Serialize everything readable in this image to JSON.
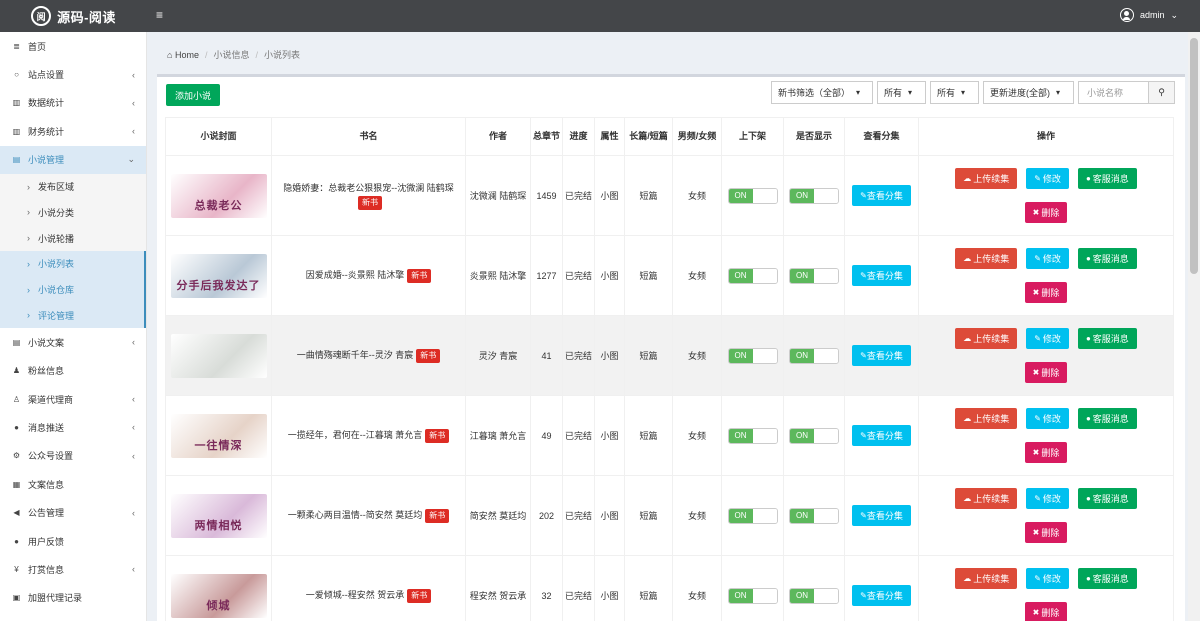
{
  "app": {
    "logo_mark": "阅",
    "title": "源码-阅读"
  },
  "header": {
    "menu_icon": "≡",
    "user": "admin"
  },
  "sidebar": {
    "items": [
      {
        "label": "首页",
        "icon": "≣",
        "arrow": ""
      },
      {
        "label": "站点设置",
        "icon": "○",
        "arrow": "‹"
      },
      {
        "label": "数据统计",
        "icon": "▥",
        "arrow": "‹"
      },
      {
        "label": "财务统计",
        "icon": "▥",
        "arrow": "‹"
      },
      {
        "label": "小说管理",
        "icon": "▤",
        "arrow": "⌄"
      },
      {
        "label": "小说文案",
        "icon": "▤",
        "arrow": "‹"
      },
      {
        "label": "粉丝信息",
        "icon": "♟",
        "arrow": ""
      },
      {
        "label": "渠道代理商",
        "icon": "♙",
        "arrow": "‹"
      },
      {
        "label": "消息推送",
        "icon": "●",
        "arrow": "‹"
      },
      {
        "label": "公众号设置",
        "icon": "⚙",
        "arrow": "‹"
      },
      {
        "label": "文案信息",
        "icon": "▦",
        "arrow": ""
      },
      {
        "label": "公告管理",
        "icon": "◀",
        "arrow": "‹"
      },
      {
        "label": "用户反馈",
        "icon": "●",
        "arrow": ""
      },
      {
        "label": "打赏信息",
        "icon": "¥",
        "arrow": "‹"
      },
      {
        "label": "加盟代理记录",
        "icon": "▣",
        "arrow": ""
      }
    ],
    "sub_items": [
      {
        "label": "发布区域"
      },
      {
        "label": "小说分类"
      },
      {
        "label": "小说轮播"
      },
      {
        "label": "小说列表"
      },
      {
        "label": "小说仓库"
      },
      {
        "label": "评论管理"
      }
    ]
  },
  "breadcrumb": {
    "home": "Home",
    "level1": "小说信息",
    "level2": "小说列表"
  },
  "toolbar": {
    "add_label": "添加小说",
    "filters": [
      "新书筛选（全部）",
      "所有",
      "所有",
      "更新进度(全部)"
    ],
    "search_placeholder": "小说名称"
  },
  "table": {
    "headers": [
      "小说封面",
      "书名",
      "作者",
      "总章节",
      "进度",
      "属性",
      "长篇/短篇",
      "男频/女频",
      "上下架",
      "是否显示",
      "查看分集",
      "操作"
    ],
    "new_badge": "新书",
    "toggle_on": "ON",
    "btn_episodes": "查看分集",
    "btn_upload": "上传续集",
    "btn_edit": "修改",
    "btn_message": "客服消息",
    "btn_delete": "删除",
    "rows": [
      {
        "cover_text": "总裁老公",
        "cover_color": "#e8b5c8",
        "title": "隐婚娇妻：总裁老公狠狠宠--沈微澜 陆鹤琛",
        "author": "沈微澜 陆鹤琛",
        "chapters": "1459",
        "progress": "已完结",
        "attribute": "小图",
        "length": "短篇",
        "gender": "女频"
      },
      {
        "cover_text": "分手后我发达了",
        "cover_color": "#b9c8d6",
        "title": "因爱成婚--炎景熙 陆沐擎",
        "author": "炎景熙 陆沐擎",
        "chapters": "1277",
        "progress": "已完结",
        "attribute": "小图",
        "length": "短篇",
        "gender": "女频"
      },
      {
        "cover_text": "",
        "cover_color": "#d8dcd8",
        "title": "一曲情殇魂断千年--灵汐 青宸",
        "author": "灵汐 青宸",
        "chapters": "41",
        "progress": "已完结",
        "attribute": "小图",
        "length": "短篇",
        "gender": "女频"
      },
      {
        "cover_text": "一往情深",
        "cover_color": "#e6d3c8",
        "title": "一揽经年，君何在--江暮璃 萧允言",
        "author": "江暮璃 萧允言",
        "chapters": "49",
        "progress": "已完结",
        "attribute": "小图",
        "length": "短篇",
        "gender": "女频"
      },
      {
        "cover_text": "两情相悦",
        "cover_color": "#d9b9d9",
        "title": "一颗柔心两目温情--简安然 莫廷均",
        "author": "简安然 莫廷均",
        "chapters": "202",
        "progress": "已完结",
        "attribute": "小图",
        "length": "短篇",
        "gender": "女频"
      },
      {
        "cover_text": "倾城",
        "cover_color": "#c89a9a",
        "title": "一爱倾城--程安然 贺云承",
        "author": "程安然 贺云承",
        "chapters": "32",
        "progress": "已完结",
        "attribute": "小图",
        "length": "短篇",
        "gender": "女频"
      }
    ]
  },
  "colors": {
    "add": "#00a65a",
    "upload": "#dd4b39",
    "edit": "#00c0ef",
    "message": "#00a65a",
    "delete": "#d81b60",
    "badge": "#dd2c24"
  }
}
